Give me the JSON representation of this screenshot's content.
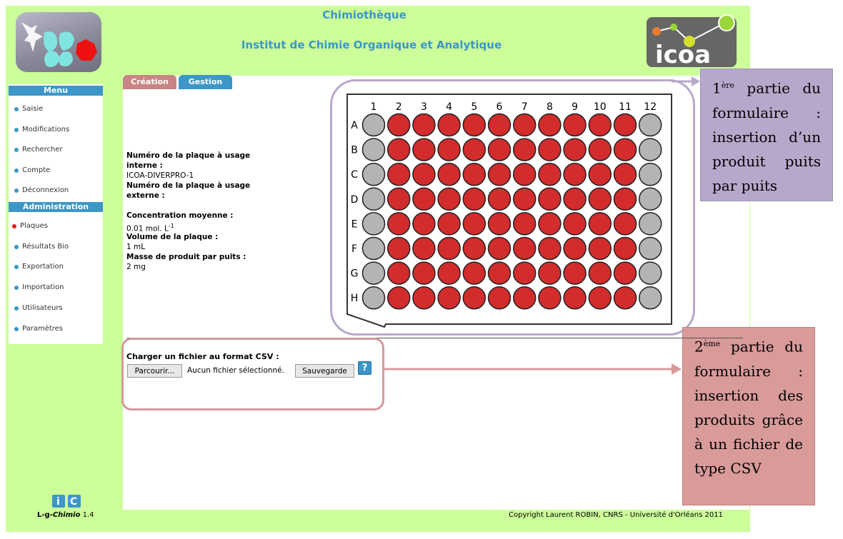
{
  "header": {
    "app_title": "Chimiothèque",
    "institute": "Institut de Chimie Organique et Analytique",
    "right_logo_text": "icoa"
  },
  "sidebar": {
    "menu_header": "Menu",
    "menu_items": [
      {
        "label": "Saisie"
      },
      {
        "label": "Modifications"
      },
      {
        "label": "Rechercher"
      },
      {
        "label": "Compte"
      },
      {
        "label": "Déconnexion"
      }
    ],
    "admin_header": "Administration",
    "admin_items": [
      {
        "label": "Plaques",
        "active": true
      },
      {
        "label": "Résultats Bio"
      },
      {
        "label": "Exportation"
      },
      {
        "label": "Importation"
      },
      {
        "label": "Utilisateurs"
      },
      {
        "label": "Paramètres"
      }
    ]
  },
  "tabs": [
    {
      "label": "Création",
      "color": "#c98585"
    },
    {
      "label": "Gestion",
      "color": "#3c96c8"
    }
  ],
  "plate_info": {
    "internal_label": "Numéro de la plaque à usage interne :",
    "internal_value": "ICOA-DIVERPRO-1",
    "external_label": "Numéro de la plaque à usage externe :",
    "concentration_label": "Concentration moyenne :",
    "concentration_value": "0.01 mol. L",
    "concentration_exp": "-1",
    "volume_label": "Volume de la plaque :",
    "volume_value": "1 mL",
    "mass_label": "Masse de produit par puits :",
    "mass_value": "2 mg"
  },
  "plate": {
    "columns": [
      "1",
      "2",
      "3",
      "4",
      "5",
      "6",
      "7",
      "8",
      "9",
      "10",
      "11",
      "12"
    ],
    "rows": [
      "A",
      "B",
      "C",
      "D",
      "E",
      "F",
      "G",
      "H"
    ],
    "empty_columns": [
      "1",
      "12"
    ],
    "filled_color": "#d22c2c",
    "empty_color": "#b4b4b4"
  },
  "callouts": {
    "first": {
      "ord": "1",
      "sup": "ère",
      "text": "partie du formulaire : insertion d’un produit puits par puits"
    },
    "second": {
      "ord": "2",
      "sup": "ème",
      "text": "partie du formulaire : insertion des produits grâce à un fichier de type CSV"
    }
  },
  "csv": {
    "label": "Charger un fichier au format CSV :",
    "browse_label": "Parcourir...",
    "no_file_text": "Aucun fichier sélectionné.",
    "save_label": "Sauvegarde",
    "help_label": "?"
  },
  "footer": {
    "app_name_prefix": "L-g-",
    "app_name_italic": "Chimio",
    "version": " 1.4",
    "copyright": "Copyright Laurent ROBIN, CNRS - Université d'Orléans 2011"
  },
  "colors": {
    "page_bg": "#ccff99",
    "accent": "#3c96c8"
  }
}
